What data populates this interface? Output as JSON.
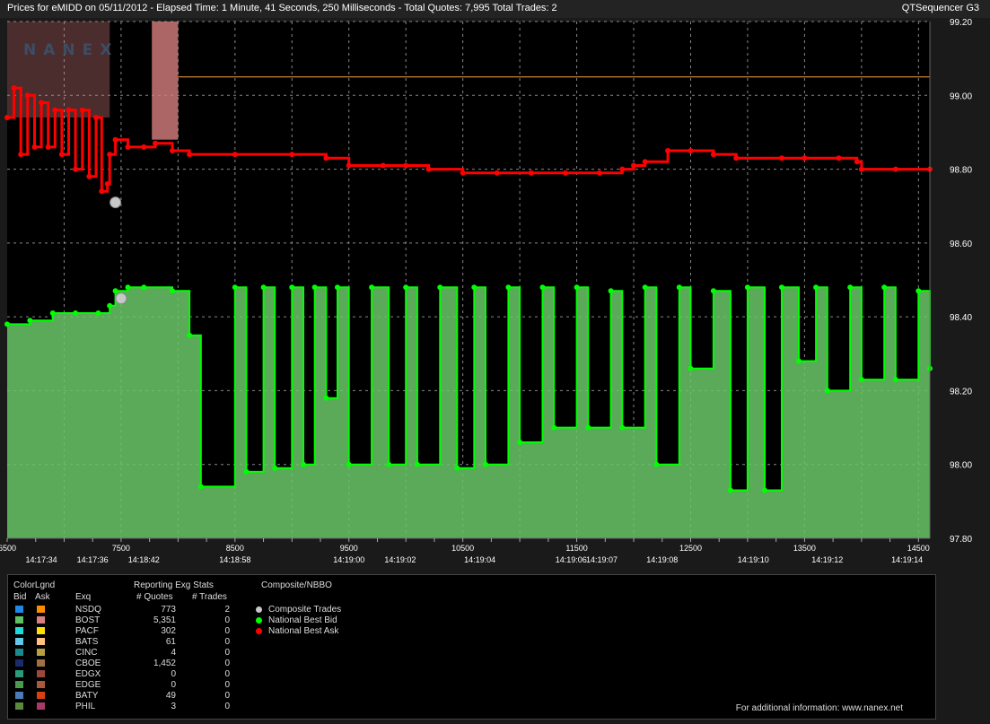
{
  "header": {
    "title": "Prices for  eMIDD  on  05/11/2012  -  Elapsed Time: 1 Minute, 41 Seconds, 250 Milliseconds  -  Total Quotes: 7,995  Total Trades: 2",
    "app_name": "QTSequencer G3"
  },
  "logo_text": "NANEX",
  "chart_data": {
    "type": "line",
    "ylim": [
      97.8,
      99.2
    ],
    "xlim": [
      6500,
      14600
    ],
    "grid": true,
    "y_ticks": [
      "99.20",
      "99.00",
      "98.80",
      "98.60",
      "98.40",
      "98.20",
      "98.00",
      "97.80"
    ],
    "x_ticks": [
      "6500",
      "7500",
      "8500",
      "9500",
      "10500",
      "11500",
      "12500",
      "13500",
      "14500"
    ],
    "time_ticks": [
      {
        "x": 6800,
        "label": "14:17:34"
      },
      {
        "x": 7250,
        "label": "14:17:36"
      },
      {
        "x": 7700,
        "label": "14:18:42"
      },
      {
        "x": 8500,
        "label": "14:18:58"
      },
      {
        "x": 9500,
        "label": "14:19:00"
      },
      {
        "x": 9950,
        "label": "14:19:02"
      },
      {
        "x": 10650,
        "label": "14:19:04"
      },
      {
        "x": 11450,
        "label": "14:19:06"
      },
      {
        "x": 11720,
        "label": "14:19:07"
      },
      {
        "x": 12250,
        "label": "14:19:08"
      },
      {
        "x": 13050,
        "label": "14:19:10"
      },
      {
        "x": 13700,
        "label": "14:19:12"
      },
      {
        "x": 14400,
        "label": "14:19:14"
      }
    ],
    "series": [
      {
        "name": "National Best Ask",
        "color": "#ff0000",
        "points": [
          [
            6500,
            98.94
          ],
          [
            6560,
            99.02
          ],
          [
            6620,
            98.84
          ],
          [
            6680,
            99.0
          ],
          [
            6740,
            98.86
          ],
          [
            6800,
            98.98
          ],
          [
            6860,
            98.86
          ],
          [
            6920,
            98.96
          ],
          [
            6980,
            98.84
          ],
          [
            7040,
            98.96
          ],
          [
            7100,
            98.8
          ],
          [
            7160,
            98.96
          ],
          [
            7220,
            98.78
          ],
          [
            7280,
            98.94
          ],
          [
            7330,
            98.74
          ],
          [
            7380,
            98.76
          ],
          [
            7400,
            98.84
          ],
          [
            7450,
            98.88
          ],
          [
            7560,
            98.86
          ],
          [
            7700,
            98.86
          ],
          [
            7800,
            98.87
          ],
          [
            7950,
            98.85
          ],
          [
            8100,
            98.84
          ],
          [
            8500,
            98.84
          ],
          [
            9000,
            98.84
          ],
          [
            9300,
            98.83
          ],
          [
            9500,
            98.81
          ],
          [
            9800,
            98.81
          ],
          [
            10000,
            98.81
          ],
          [
            10200,
            98.8
          ],
          [
            10500,
            98.79
          ],
          [
            10800,
            98.79
          ],
          [
            11100,
            98.79
          ],
          [
            11400,
            98.79
          ],
          [
            11700,
            98.79
          ],
          [
            11900,
            98.8
          ],
          [
            12000,
            98.81
          ],
          [
            12100,
            98.82
          ],
          [
            12300,
            98.85
          ],
          [
            12500,
            98.85
          ],
          [
            12700,
            98.84
          ],
          [
            12900,
            98.83
          ],
          [
            13300,
            98.83
          ],
          [
            13500,
            98.83
          ],
          [
            13800,
            98.83
          ],
          [
            13960,
            98.82
          ],
          [
            14000,
            98.8
          ],
          [
            14300,
            98.8
          ],
          [
            14600,
            98.8
          ]
        ]
      },
      {
        "name": "National Best Bid",
        "color": "#00ff00",
        "points": [
          [
            6500,
            98.38
          ],
          [
            6700,
            98.39
          ],
          [
            6900,
            98.41
          ],
          [
            7100,
            98.41
          ],
          [
            7300,
            98.41
          ],
          [
            7400,
            98.43
          ],
          [
            7450,
            98.47
          ],
          [
            7560,
            98.48
          ],
          [
            7700,
            98.48
          ],
          [
            7950,
            98.47
          ],
          [
            8100,
            98.35
          ],
          [
            8200,
            97.94
          ],
          [
            8500,
            98.48
          ],
          [
            8600,
            97.98
          ],
          [
            8750,
            98.48
          ],
          [
            8850,
            97.99
          ],
          [
            9000,
            98.48
          ],
          [
            9100,
            98.0
          ],
          [
            9200,
            98.48
          ],
          [
            9300,
            98.18
          ],
          [
            9400,
            98.48
          ],
          [
            9500,
            98.0
          ],
          [
            9700,
            98.48
          ],
          [
            9850,
            98.0
          ],
          [
            10000,
            98.48
          ],
          [
            10100,
            98.0
          ],
          [
            10300,
            98.48
          ],
          [
            10450,
            97.99
          ],
          [
            10600,
            98.48
          ],
          [
            10700,
            98.0
          ],
          [
            10900,
            98.48
          ],
          [
            11000,
            98.06
          ],
          [
            11200,
            98.48
          ],
          [
            11300,
            98.1
          ],
          [
            11500,
            98.48
          ],
          [
            11600,
            98.1
          ],
          [
            11800,
            98.47
          ],
          [
            11900,
            98.1
          ],
          [
            12100,
            98.48
          ],
          [
            12200,
            98.0
          ],
          [
            12400,
            98.48
          ],
          [
            12500,
            98.26
          ],
          [
            12700,
            98.47
          ],
          [
            12850,
            97.93
          ],
          [
            13000,
            98.48
          ],
          [
            13150,
            97.93
          ],
          [
            13300,
            98.48
          ],
          [
            13450,
            98.28
          ],
          [
            13600,
            98.48
          ],
          [
            13700,
            98.2
          ],
          [
            13900,
            98.48
          ],
          [
            14000,
            98.23
          ],
          [
            14200,
            98.48
          ],
          [
            14300,
            98.23
          ],
          [
            14500,
            98.47
          ],
          [
            14600,
            98.26
          ]
        ]
      },
      {
        "name": "Composite Trades",
        "color": "#c8c8c8",
        "points": [
          [
            7450,
            98.71
          ],
          [
            7500,
            98.45
          ]
        ]
      }
    ]
  },
  "legend": {
    "colorlgnd_label": "ColorLgnd",
    "bid_label": "Bid",
    "ask_label": "Ask",
    "exq_label": "Exq",
    "reporting_label": "Reporting Exg Stats",
    "quotes_label": "# Quotes",
    "trades_label": "# Trades",
    "composite_label": "Composite/NBBO",
    "rows": [
      {
        "exchange": "NSDQ",
        "quotes": "773",
        "trades": "2",
        "bid_color": "#1e88e5",
        "ask_color": "#ff8c00"
      },
      {
        "exchange": "BOST",
        "quotes": "5,351",
        "trades": "0",
        "bid_color": "#60c060",
        "ask_color": "#d88080"
      },
      {
        "exchange": "PACF",
        "quotes": "302",
        "trades": "0",
        "bid_color": "#20d8d8",
        "ask_color": "#ffe000"
      },
      {
        "exchange": "BATS",
        "quotes": "61",
        "trades": "0",
        "bid_color": "#60c8e8",
        "ask_color": "#ffc080"
      },
      {
        "exchange": "CINC",
        "quotes": "4",
        "trades": "0",
        "bid_color": "#1a8a8a",
        "ask_color": "#b8a040"
      },
      {
        "exchange": "CBOE",
        "quotes": "1,452",
        "trades": "0",
        "bid_color": "#1a2a6a",
        "ask_color": "#a07040"
      },
      {
        "exchange": "EDGX",
        "quotes": "0",
        "trades": "0",
        "bid_color": "#2a9a7a",
        "ask_color": "#9a4a3a"
      },
      {
        "exchange": "EDGE",
        "quotes": "0",
        "trades": "0",
        "bid_color": "#4a9a4a",
        "ask_color": "#aa5a3a"
      },
      {
        "exchange": "BATY",
        "quotes": "49",
        "trades": "0",
        "bid_color": "#4a7ab8",
        "ask_color": "#d84010"
      },
      {
        "exchange": "PHIL",
        "quotes": "3",
        "trades": "0",
        "bid_color": "#5a8a3a",
        "ask_color": "#a83a6a"
      }
    ],
    "nbbo_items": [
      {
        "label": "Composite Trades",
        "color": "#c8c8c8"
      },
      {
        "label": "National Best Bid",
        "color": "#00ff00"
      },
      {
        "label": "National Best Ask",
        "color": "#ff0000"
      }
    ]
  },
  "footer": {
    "info_text": "For additional information: www.nanex.net"
  }
}
